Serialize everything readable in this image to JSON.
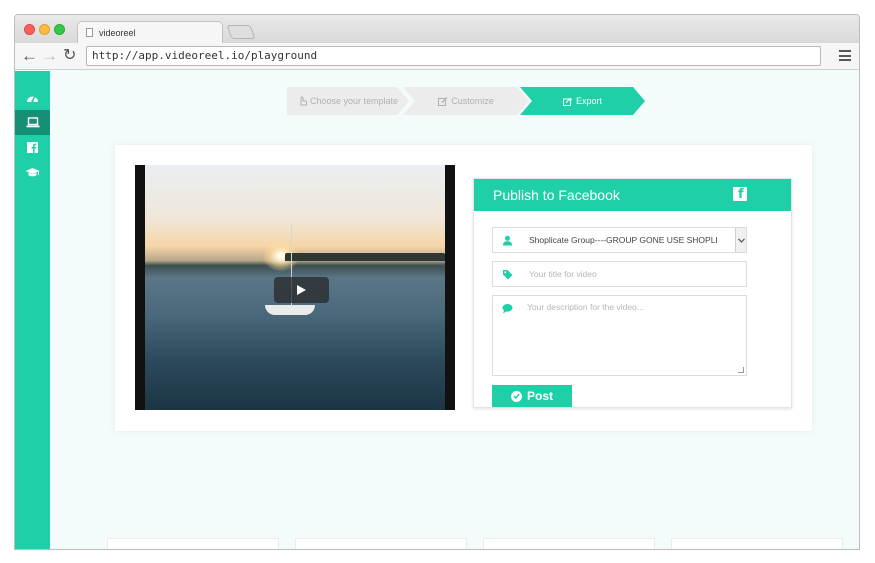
{
  "browser": {
    "tab_title": "videoreel",
    "url": "http://app.videoreel.io/playground"
  },
  "sidebar": {
    "items": [
      {
        "icon": "dashboard-icon",
        "active": false
      },
      {
        "icon": "laptop-icon",
        "active": true
      },
      {
        "icon": "facebook-icon",
        "active": false
      },
      {
        "icon": "graduation-cap-icon",
        "active": false
      }
    ]
  },
  "steps": [
    {
      "label": "Choose your template",
      "icon": "hand-pointer-icon",
      "state": "done"
    },
    {
      "label": "Customize",
      "icon": "edit-icon",
      "state": "done"
    },
    {
      "label": "Export",
      "icon": "share-icon",
      "state": "active"
    }
  ],
  "publish": {
    "title": "Publish to Facebook",
    "group_value": "Shoplicate Group----GROUP GONE USE SHOPLI",
    "title_placeholder": "Your title for video",
    "description_placeholder": "Your description for the video...",
    "post_label": "Post"
  },
  "colors": {
    "accent": "#1fcfa7",
    "accent_dark": "#168f76",
    "background": "#f3fbfb"
  }
}
